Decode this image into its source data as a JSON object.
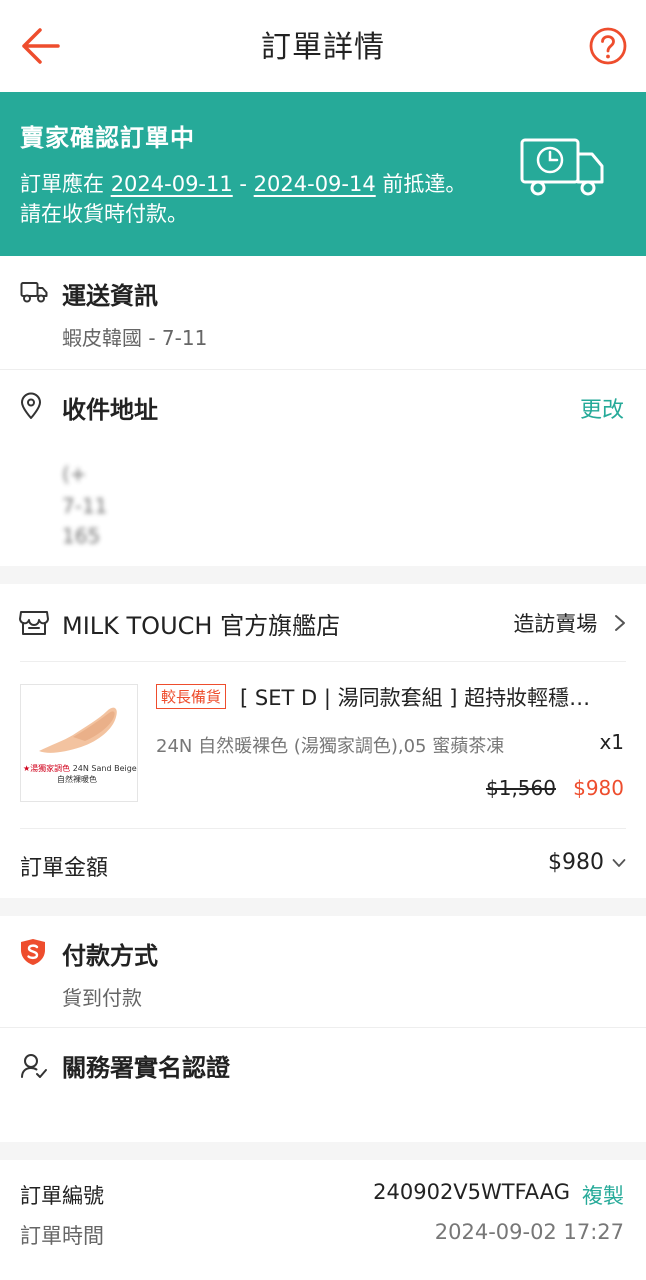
{
  "header": {
    "title": "訂單詳情",
    "back_icon": "back-arrow-icon",
    "help_icon": "help-icon",
    "accent_color": "#ee4d2d"
  },
  "banner": {
    "status": "賣家確認訂單中",
    "line1_prefix": "訂單應在 ",
    "date_from": "2024-09-11",
    "separator": " - ",
    "date_to": "2024-09-14",
    "line1_suffix": " 前抵達。",
    "line2": "請在收貨時付款。",
    "bg_color": "#26aa99",
    "icon": "delivery-truck-clock-icon"
  },
  "shipping": {
    "title": "運送資訊",
    "value": "蝦皮韓國 - 7-11",
    "icon": "truck-icon"
  },
  "address": {
    "title": "收件地址",
    "edit_label": "更改",
    "line1": "(+",
    "line2": "7-11",
    "line3": "165",
    "icon": "location-pin-icon"
  },
  "shop": {
    "name": "MILK TOUCH 官方旗艦店",
    "visit_label": "造訪賣場",
    "icon": "store-icon"
  },
  "item": {
    "tag": "較長備貨",
    "name": "[ SET D | 湯同款套組 ] 超持妝輕穩…",
    "variant": "24N 自然暖裸色 (湯獨家調色),05 蜜蘋茶凍",
    "qty": "x1",
    "original_price": "$1,560",
    "price": "$980",
    "thumb_line1_red": "★湯獨家調色",
    "thumb_line1_dark": " 24N Sand Beige",
    "thumb_line2": "自然裸暖色"
  },
  "total": {
    "label": "訂單金額",
    "amount": "$980"
  },
  "payment": {
    "title": "付款方式",
    "value": "貨到付款",
    "icon": "shield-s-icon"
  },
  "verification": {
    "title": "關務署實名認證",
    "icon": "user-check-icon"
  },
  "order": {
    "number_label": "訂單編號",
    "number": "240902V5WTFAAG",
    "copy_label": "複製",
    "time_label": "訂單時間",
    "time": "2024-09-02 17:27"
  }
}
